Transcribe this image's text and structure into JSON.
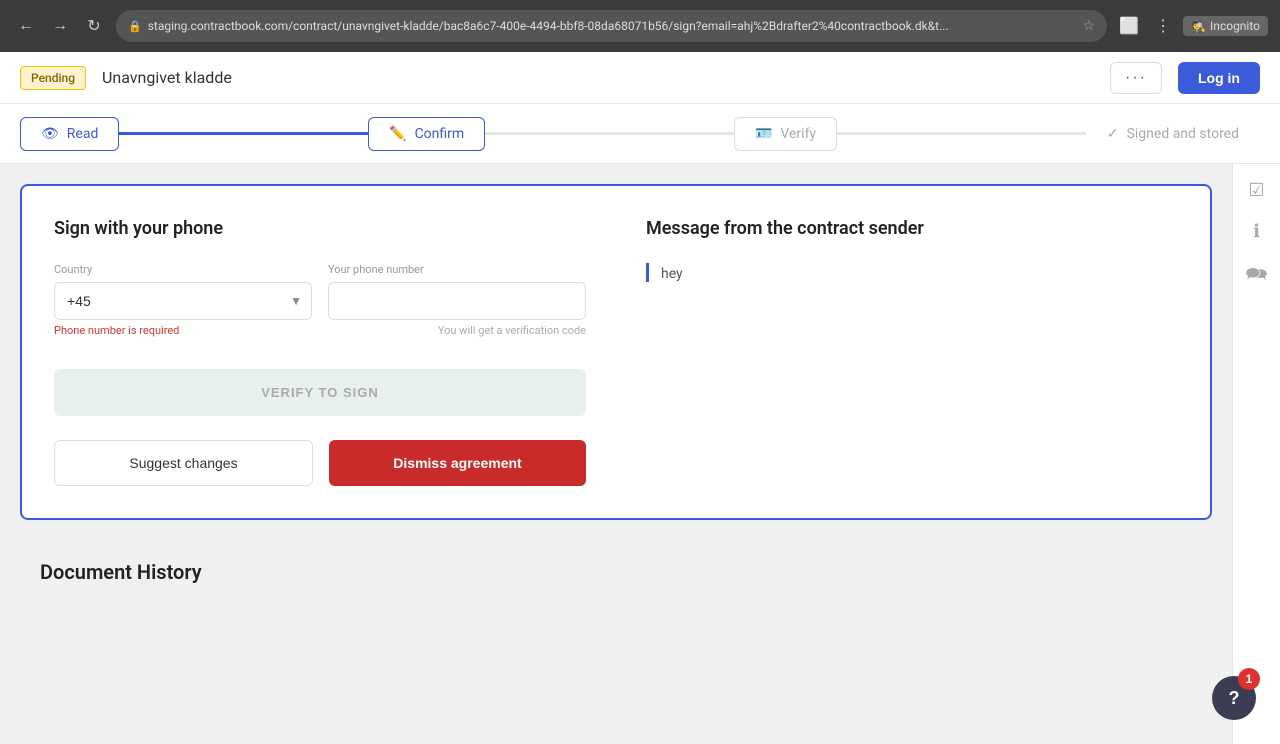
{
  "browser": {
    "url": "staging.contractbook.com/contract/unavngivet-kladde/bac8a6c7-400e-4494-bbf8-08da68071b56/sign?email=ahj%2Bdrafter2%40contractbook.dk&t...",
    "incognito_label": "Incognito"
  },
  "header": {
    "pending_label": "Pending",
    "doc_title": "Unavngivet kladde",
    "more_label": "···",
    "login_label": "Log in"
  },
  "steps": [
    {
      "id": "read",
      "label": "Read",
      "icon": "👁",
      "state": "active"
    },
    {
      "id": "confirm",
      "label": "Confirm",
      "icon": "✏️",
      "state": "active"
    },
    {
      "id": "verify",
      "label": "Verify",
      "icon": "🪪",
      "state": "inactive"
    },
    {
      "id": "signed",
      "label": "Signed and stored",
      "icon": "✓",
      "state": "inactive"
    }
  ],
  "sign_panel": {
    "title": "Sign with your phone",
    "country_label": "Country",
    "country_value": "+45",
    "phone_label": "Your phone number",
    "phone_placeholder": "",
    "error_text": "Phone number is required",
    "hint_text": "You will get a verification code",
    "verify_btn_label": "VERIFY TO SIGN",
    "suggest_btn_label": "Suggest changes",
    "dismiss_btn_label": "Dismiss agreement"
  },
  "message": {
    "title": "Message from the contract sender",
    "text": "hey"
  },
  "sidebar_icons": [
    "☑",
    "ℹ",
    "🗪"
  ],
  "doc_history": {
    "title": "Document History"
  },
  "help": {
    "notification_count": "1",
    "label": "?"
  }
}
